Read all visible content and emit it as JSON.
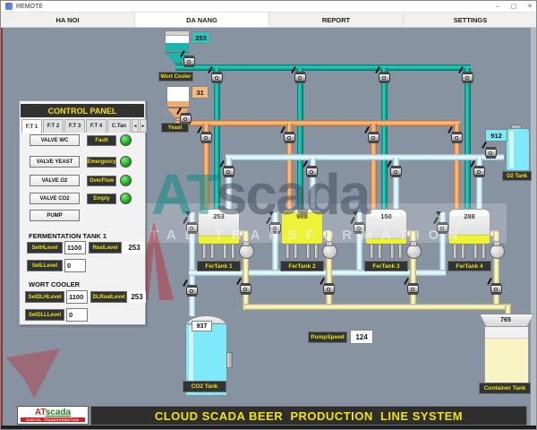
{
  "window": {
    "title": "REMOTE",
    "minimize": "–",
    "maximize": "▢",
    "close": "✕"
  },
  "nav_tabs": [
    {
      "label": "HA NOI",
      "active": false
    },
    {
      "label": "DA NANG",
      "active": true
    },
    {
      "label": "REPORT",
      "active": false
    },
    {
      "label": "SETTINGS",
      "active": false
    }
  ],
  "control_panel": {
    "title": "CONTROL PANEL",
    "tabs": [
      {
        "label": "F.T 1",
        "active": true
      },
      {
        "label": "F.T 2",
        "active": false
      },
      {
        "label": "F.T 3",
        "active": false
      },
      {
        "label": "F.T 4",
        "active": false
      },
      {
        "label": "C.Tan",
        "active": false
      }
    ],
    "tab_scroll_left": "◄",
    "tab_scroll_right": "►",
    "valve_buttons": [
      {
        "label": "VALVE WC"
      },
      {
        "label": "VALVE YEAST"
      },
      {
        "label": "VALVE O2"
      },
      {
        "label": "VALVE CO2"
      },
      {
        "label": "PUMP"
      }
    ],
    "indicators": [
      {
        "label": "Fault",
        "state": "green"
      },
      {
        "label": "Emergency",
        "state": "green"
      },
      {
        "label": "OverFlow",
        "state": "green"
      },
      {
        "label": "Empty",
        "state": "green"
      }
    ],
    "fermentation_tank_1": {
      "heading": "FERMENTATION TANK 1",
      "set_h_label": "SetHLevel",
      "set_h_value": "1100",
      "real_label": "RealLevel",
      "real_value": "253",
      "set_l_label": "SetLLevel",
      "set_l_value": "0"
    },
    "wort_cooler": {
      "heading": "WORT COOLER",
      "set_h_label": "SetDLHLevel",
      "set_h_value": "1100",
      "real_label": "DLRealLevel",
      "real_value": "253",
      "set_l_label": "SetDLLLevel",
      "set_l_value": "0"
    }
  },
  "diagram": {
    "wort_hopper": {
      "label": "Wort Cooler",
      "value": "253"
    },
    "yeast_hopper": {
      "label": "Yeast",
      "value": "31"
    },
    "o2_tank": {
      "label": "O2 Tank",
      "value": "912"
    },
    "co2_tank": {
      "label": "CO2 Tank",
      "value": "937"
    },
    "container_tank": {
      "label": "Container Tank",
      "value": "765"
    },
    "pump_speed": {
      "label": "PumpSpeed",
      "value": "124"
    },
    "fermentation_tanks": [
      {
        "label": "FerTank 1",
        "value": "253",
        "level_pct": 23
      },
      {
        "label": "FerTank 2",
        "value": "988",
        "level_pct": 88
      },
      {
        "label": "FerTank 3",
        "value": "150",
        "level_pct": 14
      },
      {
        "label": "FerTank 4",
        "value": "288",
        "level_pct": 26
      }
    ]
  },
  "watermark": {
    "brand_a": "AT",
    "brand_b": "scada",
    "tagline": "DIGITAL TRANSFORMATION"
  },
  "footer": {
    "logo_a": "AT",
    "logo_b": "scada",
    "logo_tagline": "DIGITAL TRANSFORMATION",
    "banner": "CLOUD SCADA BEER  PRODUCTION  LINE SYSTEM"
  },
  "colors": {
    "teal_pipe": "#10b2a2",
    "orange_pipe": "#f2a96c",
    "light_pipe": "#d9f2fa",
    "beer_pipe": "#f6f2ba",
    "tank_fill": "#ecf005",
    "cyan_fill": "#7de9fa",
    "led_green": "#18a818",
    "accent_yellow": "#f8df00"
  }
}
